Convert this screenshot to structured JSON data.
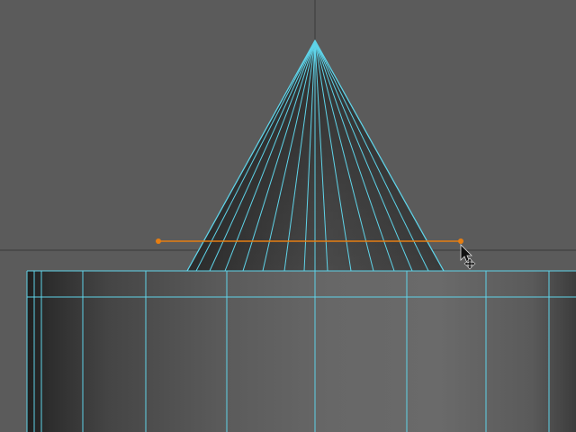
{
  "viewport": {
    "background": "#5b5b5b",
    "grid_line_color": "#3a3a3a",
    "wireframe_color": "#5fd3e8",
    "manipulator_color": "#e67e12"
  },
  "scene": {
    "objects": [
      {
        "kind": "cone",
        "segments": 16,
        "selected": true
      },
      {
        "kind": "cylinder",
        "segments": 16,
        "selected": true
      }
    ],
    "tool": {
      "name": "move-tool",
      "cursor_icon": "move-cursor-icon",
      "handle_icon": "translate-handle-icon"
    }
  }
}
